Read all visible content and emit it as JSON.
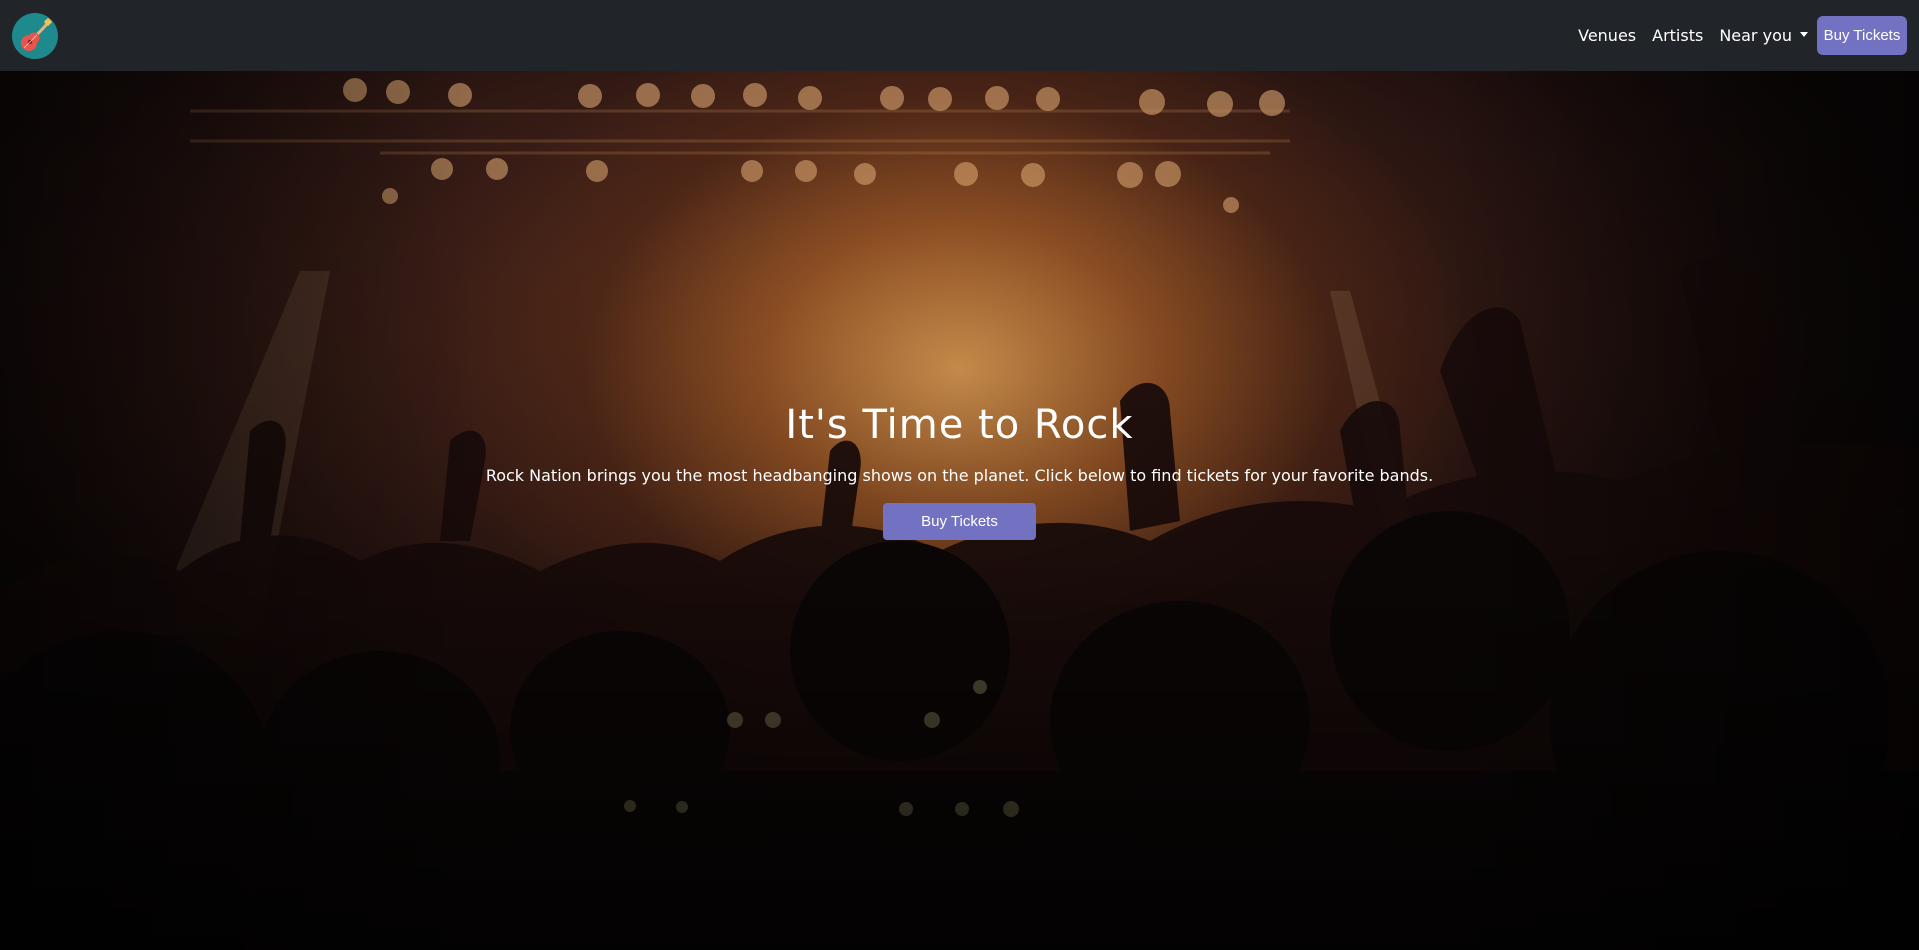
{
  "navbar": {
    "logo_icon": "guitar-icon",
    "links": {
      "venues": "Venues",
      "artists": "Artists",
      "near_you": "Near you"
    },
    "buy_label": "Buy Tickets"
  },
  "hero": {
    "title": "It's Time to Rock",
    "subtitle": "Rock Nation brings you the most headbanging shows on the planet. Click below to find tickets for your favorite bands.",
    "buy_label": "Buy Tickets",
    "background": "concert-crowd-photo"
  },
  "colors": {
    "navbar_bg": "#212529",
    "accent": "#7371c2",
    "logo_bg": "#1f8a8e",
    "text": "#ffffff"
  }
}
